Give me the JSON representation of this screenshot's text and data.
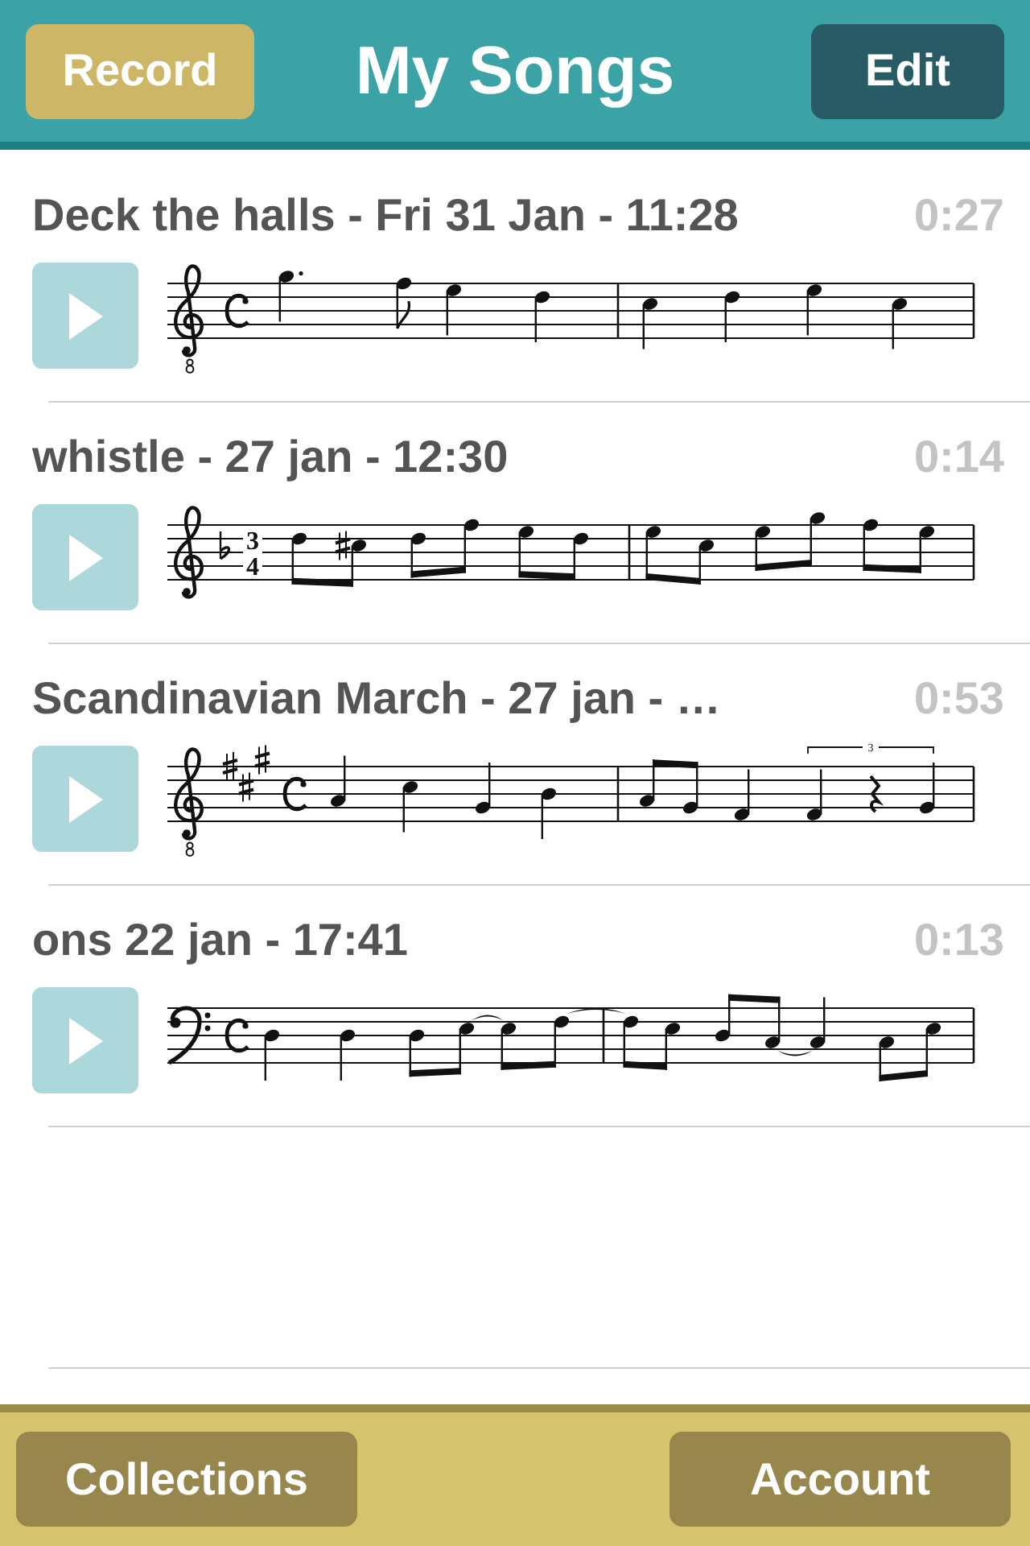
{
  "header": {
    "record_button": "Record",
    "title": "My Songs",
    "edit_button": "Edit"
  },
  "songs": [
    {
      "title": "Deck the halls - Fri 31 Jan - 11:28",
      "duration": "0:27",
      "score": {
        "clef": {
          "kind": "treble_8"
        },
        "time_signature": {
          "kind": "common"
        }
      }
    },
    {
      "title": "whistle - 27 jan - 12:30",
      "duration": "0:14",
      "score": {
        "clef": {
          "kind": "treble"
        },
        "key_signature": {
          "kind": "one_flat"
        },
        "time_signature": {
          "kind": "numeric",
          "upper": "3",
          "lower": "4"
        }
      }
    },
    {
      "title": "Scandinavian March - 27 jan - …",
      "duration": "0:53",
      "score": {
        "clef": {
          "kind": "treble_8"
        },
        "key_signature": {
          "kind": "three_sharps"
        },
        "time_signature": {
          "kind": "common"
        },
        "tuplet_label": "3"
      }
    },
    {
      "title": "ons 22 jan - 17:41",
      "duration": "0:13",
      "score": {
        "clef": {
          "kind": "bass"
        },
        "time_signature": {
          "kind": "common"
        }
      }
    }
  ],
  "footer": {
    "collections_button": "Collections",
    "account_button": "Account"
  }
}
